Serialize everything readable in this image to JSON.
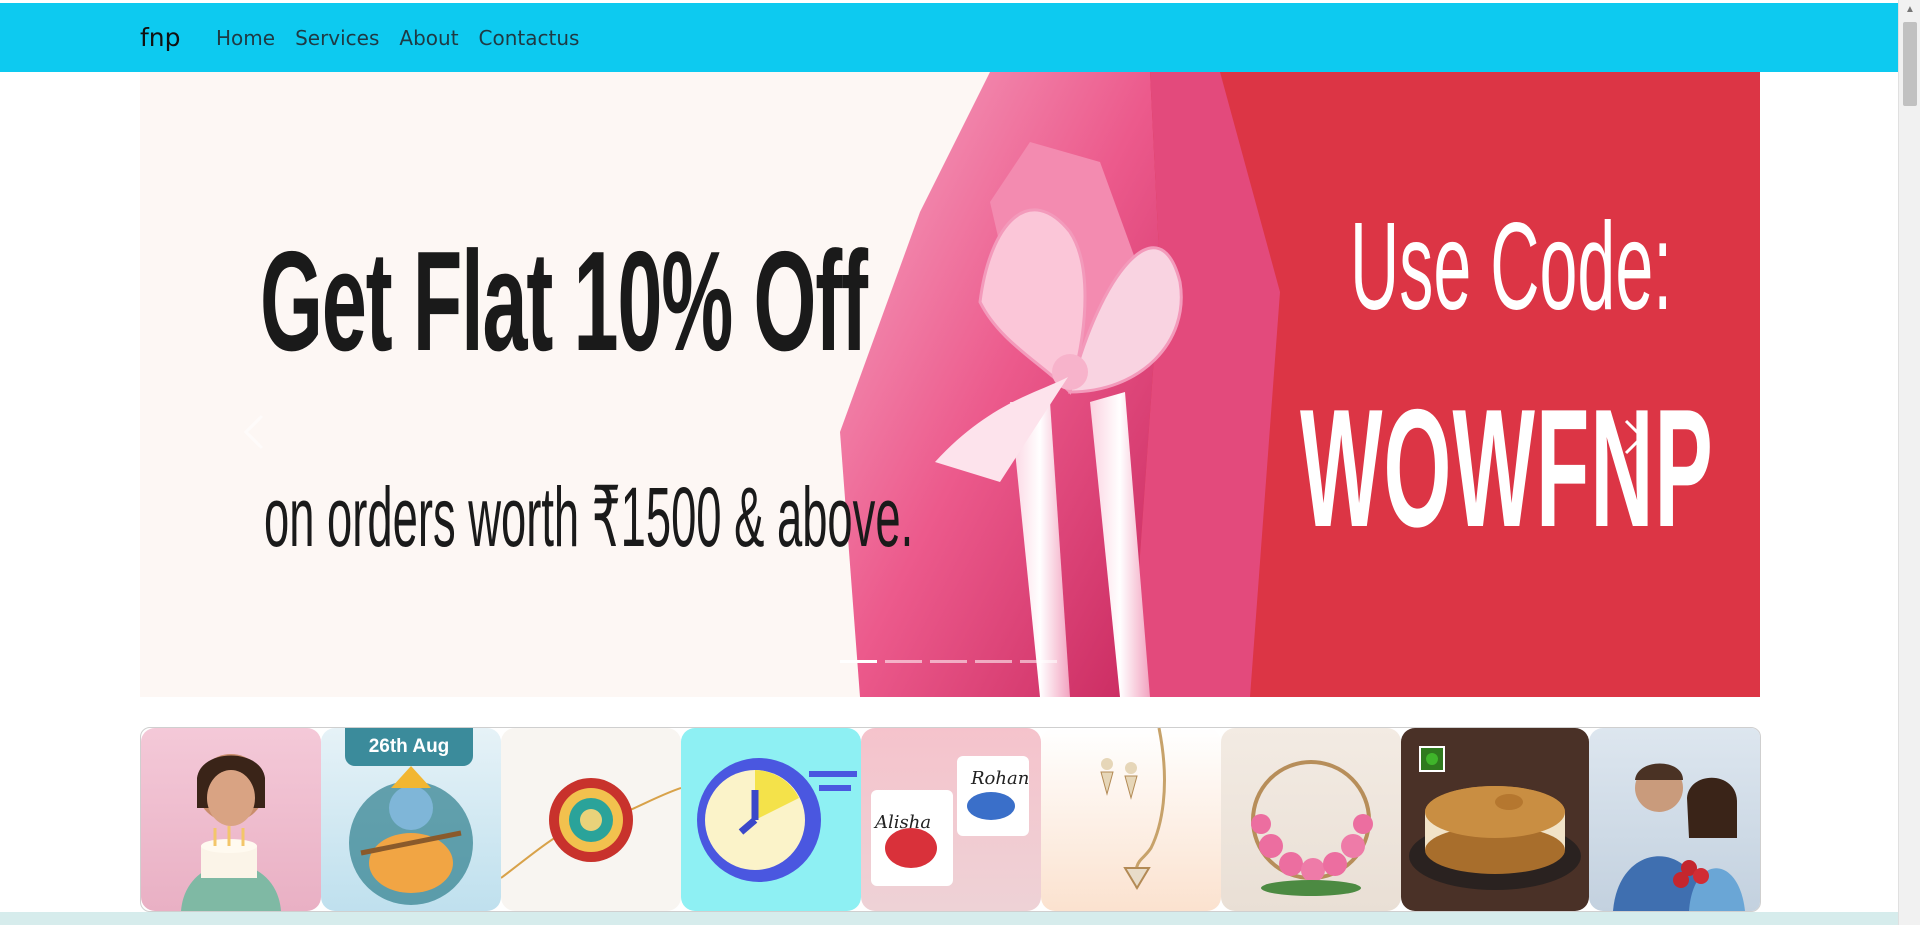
{
  "navbar": {
    "brand": "fnp",
    "links": [
      "Home",
      "Services",
      "About",
      "Contactus"
    ]
  },
  "carousel": {
    "headline": "Get Flat 10% Off",
    "subline": "on orders worth ₹1500 & above.",
    "code_label": "Use Code:",
    "code_value": "WOWFNP",
    "slides_count": 5,
    "active_slide": 1,
    "prev_icon": "chevron-left-icon",
    "next_icon": "chevron-right-icon"
  },
  "categories": {
    "date_badge": "26th Aug",
    "tiles": [
      "birthday",
      "janmashtami",
      "rakhi",
      "same-day-delivery",
      "personalised-mugs",
      "jewellery",
      "flowers",
      "cakes",
      "anniversary"
    ]
  },
  "colors": {
    "navbar": "#0dcaf0",
    "banner_red": "#dc3545",
    "banner_cream": "#fdf7f4"
  }
}
